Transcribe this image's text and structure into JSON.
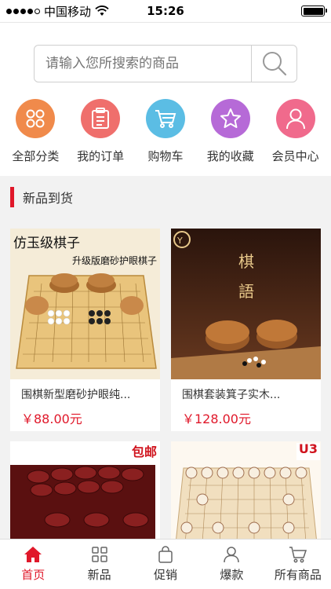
{
  "status": {
    "carrier": "中国移动",
    "time": "15:26"
  },
  "search": {
    "placeholder": "请输入您所搜索的商品"
  },
  "categories": [
    {
      "label": "全部分类",
      "icon": "grid-icon",
      "color": "#f08a4b"
    },
    {
      "label": "我的订单",
      "icon": "order-list-icon",
      "color": "#ef6f6c"
    },
    {
      "label": "购物车",
      "icon": "cart-icon",
      "color": "#5bbde4"
    },
    {
      "label": "我的收藏",
      "icon": "star-icon",
      "color": "#b66ad7"
    },
    {
      "label": "会员中心",
      "icon": "user-icon",
      "color": "#f06a8c"
    }
  ],
  "section": {
    "title": "新品到货"
  },
  "products": [
    {
      "name": "围棋新型磨砂护眼纯...",
      "price": "￥88.00元",
      "image_text_1": "仿玉级棋子",
      "image_text_2": "升级版磨砂护眼棋子"
    },
    {
      "name": "围棋套装箕子实木...",
      "price": "￥128.00元",
      "image_text_1": "棋",
      "image_text_2": "語"
    },
    {
      "name": "",
      "price": "",
      "image_text_1": "包邮"
    },
    {
      "name": "",
      "price": "",
      "image_text_1": "U3"
    }
  ],
  "tabs": [
    {
      "label": "首页",
      "icon": "home-icon",
      "active": true
    },
    {
      "label": "新品",
      "icon": "grid-icon",
      "active": false
    },
    {
      "label": "促销",
      "icon": "bag-icon",
      "active": false
    },
    {
      "label": "爆款",
      "icon": "user-icon",
      "active": false
    },
    {
      "label": "所有商品",
      "icon": "cart-icon",
      "active": false
    }
  ],
  "colors": {
    "accent": "#e0182a"
  }
}
